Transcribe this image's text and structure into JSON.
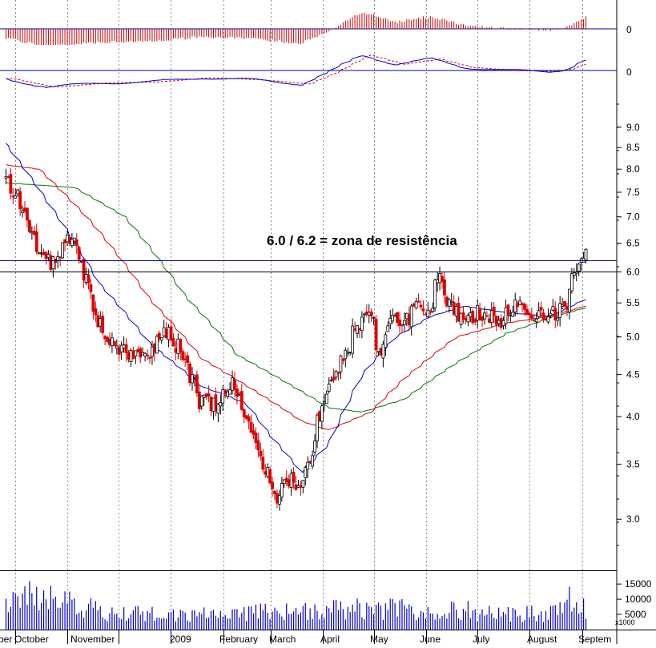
{
  "chart_data": {
    "type": "candlestick",
    "annotation": "6.0 / 6.2 = zona de resistência",
    "price_axis": {
      "scale": "log",
      "ylim": [
        2.6,
        9.6
      ],
      "ticks": [
        "9.0",
        "8.5",
        "8.0",
        "7.5",
        "7.0",
        "6.5",
        "6.0",
        "5.5",
        "5.0",
        "4.5",
        "4.0",
        "3.5",
        "3.0"
      ]
    },
    "indicator_1": {
      "type": "histogram",
      "zero_label": "0"
    },
    "indicator_2": {
      "type": "line",
      "zero_label": "0"
    },
    "volume_axis": {
      "ticks": [
        "15000",
        "10000",
        "5000"
      ],
      "multiplier": "x1000",
      "ylim": [
        0,
        19000
      ]
    },
    "resistance_levels": [
      6.0,
      6.2
    ],
    "months": [
      "ber",
      "October",
      "November",
      "2009",
      "February",
      "March",
      "April",
      "May",
      "June",
      "July",
      "August",
      "Septem"
    ],
    "time_range": [
      "2008-09-25",
      "2009-09-04"
    ],
    "price_anchors": [
      [
        "2008-09-25",
        7.8
      ],
      [
        "2008-10-05",
        7.2
      ],
      [
        "2008-10-15",
        6.4
      ],
      [
        "2008-10-25",
        6.1
      ],
      [
        "2008-11-01",
        6.7
      ],
      [
        "2008-11-08",
        6.3
      ],
      [
        "2008-11-18",
        5.3
      ],
      [
        "2008-11-28",
        4.9
      ],
      [
        "2008-12-08",
        4.8
      ],
      [
        "2008-12-18",
        4.65
      ],
      [
        "2008-12-28",
        5.1
      ],
      [
        "2009-01-08",
        4.8
      ],
      [
        "2009-01-18",
        4.2
      ],
      [
        "2009-01-28",
        4.1
      ],
      [
        "2009-02-05",
        4.4
      ],
      [
        "2009-02-12",
        4.15
      ],
      [
        "2009-02-20",
        3.7
      ],
      [
        "2009-02-27",
        3.45
      ],
      [
        "2009-03-05",
        3.1
      ],
      [
        "2009-03-10",
        3.4
      ],
      [
        "2009-03-18",
        3.3
      ],
      [
        "2009-03-25",
        3.6
      ],
      [
        "2009-04-01",
        4.1
      ],
      [
        "2009-04-08",
        4.5
      ],
      [
        "2009-04-15",
        4.8
      ],
      [
        "2009-04-22",
        5.2
      ],
      [
        "2009-04-30",
        5.3
      ],
      [
        "2009-05-05",
        4.8
      ],
      [
        "2009-05-12",
        5.2
      ],
      [
        "2009-05-20",
        5.15
      ],
      [
        "2009-05-27",
        5.6
      ],
      [
        "2009-06-03",
        5.4
      ],
      [
        "2009-06-10",
        5.9
      ],
      [
        "2009-06-17",
        5.4
      ],
      [
        "2009-06-25",
        5.3
      ],
      [
        "2009-07-05",
        5.35
      ],
      [
        "2009-07-15",
        5.2
      ],
      [
        "2009-07-25",
        5.5
      ],
      [
        "2009-08-05",
        5.3
      ],
      [
        "2009-08-15",
        5.35
      ],
      [
        "2009-08-25",
        5.4
      ],
      [
        "2009-08-28",
        6.1
      ],
      [
        "2009-09-01",
        6.05
      ],
      [
        "2009-09-04",
        6.45
      ]
    ],
    "ma_fast_anchors": [
      [
        "2008-09-25",
        8.6
      ],
      [
        "2008-10-20",
        7.3
      ],
      [
        "2008-11-20",
        5.8
      ],
      [
        "2008-12-20",
        4.9
      ],
      [
        "2009-01-20",
        4.35
      ],
      [
        "2009-02-15",
        4.15
      ],
      [
        "2009-03-01",
        3.8
      ],
      [
        "2009-03-20",
        3.42
      ],
      [
        "2009-04-05",
        3.7
      ],
      [
        "2009-04-25",
        4.5
      ],
      [
        "2009-05-15",
        5.0
      ],
      [
        "2009-06-05",
        5.3
      ],
      [
        "2009-06-25",
        5.45
      ],
      [
        "2009-07-20",
        5.35
      ],
      [
        "2009-08-15",
        5.3
      ],
      [
        "2009-09-04",
        5.55
      ]
    ],
    "ma_mid_anchors": [
      [
        "2008-09-25",
        8.1
      ],
      [
        "2008-10-15",
        8.0
      ],
      [
        "2008-11-15",
        6.9
      ],
      [
        "2008-12-20",
        5.55
      ],
      [
        "2009-01-20",
        4.7
      ],
      [
        "2009-02-20",
        4.3
      ],
      [
        "2009-03-20",
        3.95
      ],
      [
        "2009-04-05",
        3.85
      ],
      [
        "2009-04-30",
        4.05
      ],
      [
        "2009-05-20",
        4.45
      ],
      [
        "2009-06-20",
        5.0
      ],
      [
        "2009-07-20",
        5.2
      ],
      [
        "2009-08-15",
        5.3
      ],
      [
        "2009-09-04",
        5.45
      ]
    ],
    "ma_slow_anchors": [
      [
        "2008-09-25",
        7.7
      ],
      [
        "2008-11-05",
        7.6
      ],
      [
        "2008-12-05",
        7.0
      ],
      [
        "2009-01-10",
        5.6
      ],
      [
        "2009-02-10",
        4.75
      ],
      [
        "2009-03-15",
        4.35
      ],
      [
        "2009-04-05",
        4.1
      ],
      [
        "2009-04-25",
        4.05
      ],
      [
        "2009-05-20",
        4.2
      ],
      [
        "2009-06-20",
        4.65
      ],
      [
        "2009-07-20",
        5.05
      ],
      [
        "2009-08-15",
        5.28
      ],
      [
        "2009-09-04",
        5.42
      ]
    ],
    "volume_anchors": [
      [
        "2008-09-25",
        8000
      ],
      [
        "2008-10-10",
        11000
      ],
      [
        "2008-10-25",
        9000
      ],
      [
        "2008-11-20",
        6500
      ],
      [
        "2008-12-20",
        5000
      ],
      [
        "2009-01-20",
        4800
      ],
      [
        "2009-02-20",
        5500
      ],
      [
        "2009-03-15",
        5800
      ],
      [
        "2009-04-10",
        6500
      ],
      [
        "2009-05-15",
        6800
      ],
      [
        "2009-06-15",
        6500
      ],
      [
        "2009-07-15",
        5500
      ],
      [
        "2009-08-15",
        5200
      ],
      [
        "2009-08-28",
        12000
      ],
      [
        "2009-09-04",
        6000
      ]
    ],
    "osc_anchors": [
      [
        "2008-09-25",
        -0.4
      ],
      [
        "2008-10-20",
        -0.8
      ],
      [
        "2008-11-20",
        -0.6
      ],
      [
        "2008-12-20",
        -0.55
      ],
      [
        "2009-01-20",
        -0.35
      ],
      [
        "2009-02-20",
        -0.45
      ],
      [
        "2009-03-20",
        -0.65
      ],
      [
        "2009-04-05",
        -0.1
      ],
      [
        "2009-04-25",
        0.75
      ],
      [
        "2009-05-15",
        0.3
      ],
      [
        "2009-06-05",
        0.55
      ],
      [
        "2009-06-25",
        0.15
      ],
      [
        "2009-07-20",
        0.0
      ],
      [
        "2009-08-15",
        -0.05
      ],
      [
        "2009-08-25",
        0.1
      ],
      [
        "2009-09-04",
        0.5
      ]
    ],
    "series_colors": {
      "up_candle": "#ffffff",
      "down_candle": "#dd0000",
      "candle_outline": "#000000",
      "ma_fast": "#0000cc",
      "ma_mid": "#dd0000",
      "ma_slow": "#007700",
      "resistance": "#000080",
      "histogram": "#cc0000",
      "volume": "#0000cc",
      "grid": "#888888"
    }
  }
}
